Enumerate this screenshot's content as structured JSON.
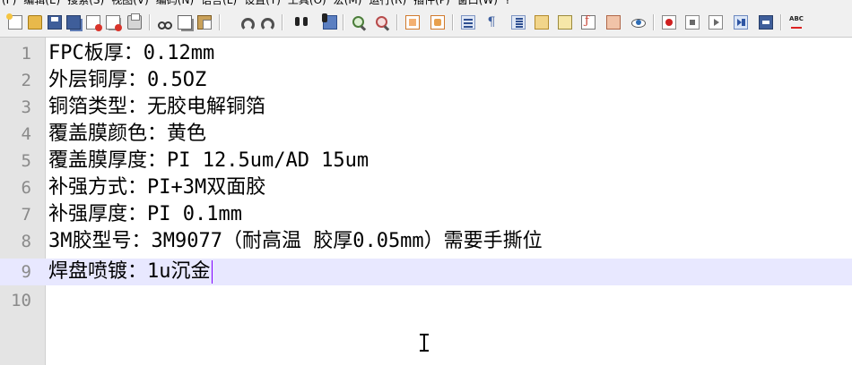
{
  "menu": {
    "items": [
      "(F)",
      "编辑(E)",
      "搜索(S)",
      "视图(V)",
      "编码(N)",
      "语言(L)",
      "设置(T)",
      "工具(O)",
      "宏(M)",
      "运行(R)",
      "插件(P)",
      "窗口(W)",
      "?"
    ]
  },
  "toolbar": {
    "buttons": [
      {
        "icon": "new-file-icon"
      },
      {
        "icon": "open-file-icon"
      },
      {
        "icon": "save-icon"
      },
      {
        "icon": "save-all-icon"
      },
      {
        "icon": "close-icon"
      },
      {
        "icon": "close-all-icon"
      },
      {
        "icon": "print-icon"
      },
      {
        "icon": "cut-icon"
      },
      {
        "icon": "copy-icon"
      },
      {
        "icon": "paste-icon"
      },
      {
        "icon": "undo-icon"
      },
      {
        "icon": "redo-icon"
      },
      {
        "icon": "find-icon"
      },
      {
        "icon": "replace-icon"
      },
      {
        "icon": "zoom-in-icon"
      },
      {
        "icon": "zoom-out-icon"
      },
      {
        "icon": "sync-vertical-icon"
      },
      {
        "icon": "sync-horizontal-icon"
      },
      {
        "icon": "word-wrap-icon"
      },
      {
        "icon": "show-all-characters-icon"
      },
      {
        "icon": "indent-guide-icon"
      },
      {
        "icon": "document-map-icon"
      },
      {
        "icon": "document-list-icon"
      },
      {
        "icon": "function-list-icon"
      },
      {
        "icon": "folder-as-workspace-icon"
      },
      {
        "icon": "monitoring-icon"
      },
      {
        "icon": "record-macro-icon"
      },
      {
        "icon": "stop-recording-icon"
      },
      {
        "icon": "playback-macro-icon"
      },
      {
        "icon": "run-macro-multiple-icon"
      },
      {
        "icon": "save-macro-icon"
      },
      {
        "icon": "spell-check-icon",
        "label": "ABC"
      }
    ]
  },
  "editor": {
    "current_line": 9,
    "lines": [
      {
        "number": "1",
        "text": "FPC板厚：0.12mm"
      },
      {
        "number": "2",
        "text": "外层铜厚：0.5OZ"
      },
      {
        "number": "3",
        "text": "铜箔类型：无胶电解铜箔"
      },
      {
        "number": "4",
        "text": "覆盖膜颜色：黄色"
      },
      {
        "number": "5",
        "text": "覆盖膜厚度：PI 12.5um/AD 15um"
      },
      {
        "number": "6",
        "text": "补强方式：PI+3M双面胶"
      },
      {
        "number": "7",
        "text": "补强厚度：PI 0.1mm"
      },
      {
        "number": "8",
        "text": "3M胶型号：3M9077（耐高温 胶厚0.05mm）需要手撕位"
      },
      {
        "number": "9",
        "text": "焊盘喷镀：1u沉金"
      },
      {
        "number": "10",
        "text": ""
      }
    ]
  },
  "colors": {
    "current_line_bg": "#e8e8ff",
    "gutter_bg": "#e4e4e4",
    "caret": "#8000ff"
  }
}
